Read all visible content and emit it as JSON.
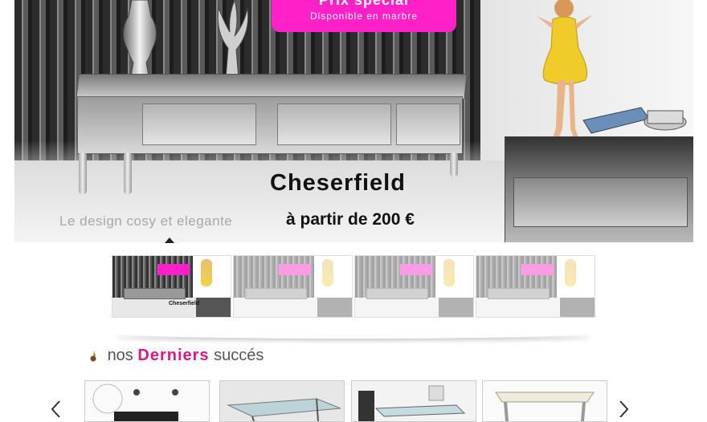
{
  "hero": {
    "promo_title": "Prix spécial",
    "promo_sub": "Disponible en marbre",
    "brand": "Cheserfield",
    "tagline": "Le design cosy et elegante",
    "price": "à partir de 200 €"
  },
  "thumbnails": [
    {
      "label": "Cheserfield",
      "active": true
    },
    {
      "label": "",
      "active": false
    },
    {
      "label": "",
      "active": false
    },
    {
      "label": "",
      "active": false
    }
  ],
  "section": {
    "title_pre": "nos",
    "title_highlight": "Derniers",
    "title_post": "succés"
  },
  "colors": {
    "accent": "#ff21c8",
    "highlight": "#e3148a"
  }
}
